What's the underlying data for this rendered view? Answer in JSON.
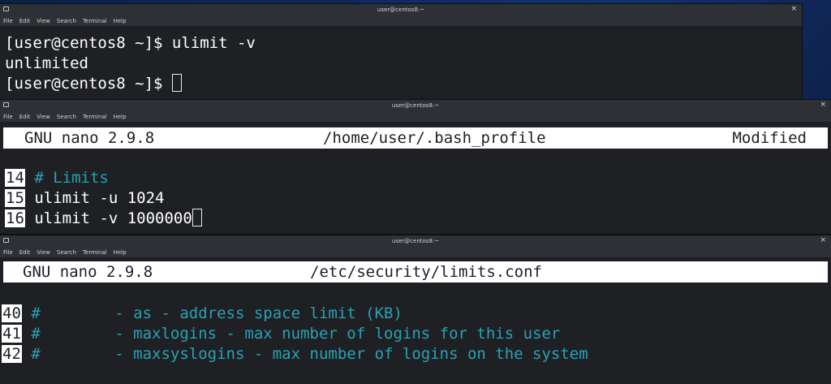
{
  "menu_labels": [
    "File",
    "Edit",
    "View",
    "Search",
    "Terminal",
    "Help"
  ],
  "windows": [
    {
      "title": "user@centos8:~",
      "lines": [
        "[user@centos8 ~]$ ulimit -v",
        "unlimited",
        "[user@centos8 ~]$ "
      ]
    },
    {
      "title": "user@centos8:~",
      "nano_version": "GNU nano 2.9.8",
      "file": "/home/user/.bash_profile",
      "status": "Modified",
      "rows": [
        {
          "num": "14",
          "text": " # Limits"
        },
        {
          "num": "15",
          "text": " ulimit -u 1024"
        },
        {
          "num": "16",
          "text": " ulimit -v 1000000"
        }
      ]
    },
    {
      "title": "user@centos8:~",
      "nano_version": "GNU nano 2.9.8",
      "file": "/etc/security/limits.conf",
      "rows": [
        {
          "num": "40",
          "text": " #        - as - address space limit (KB)"
        },
        {
          "num": "41",
          "text": " #        - maxlogins - max number of logins for this user"
        },
        {
          "num": "42",
          "text": " #        - maxsyslogins - max number of logins on the system"
        }
      ]
    }
  ],
  "colors": {
    "terminal_bg": "#1e2024",
    "comment_cyan": "#2aa1b3",
    "header_bg": "#ffffff"
  },
  "icons": {
    "window_icon": "terminal-window-icon",
    "close_icon": "close-icon"
  }
}
